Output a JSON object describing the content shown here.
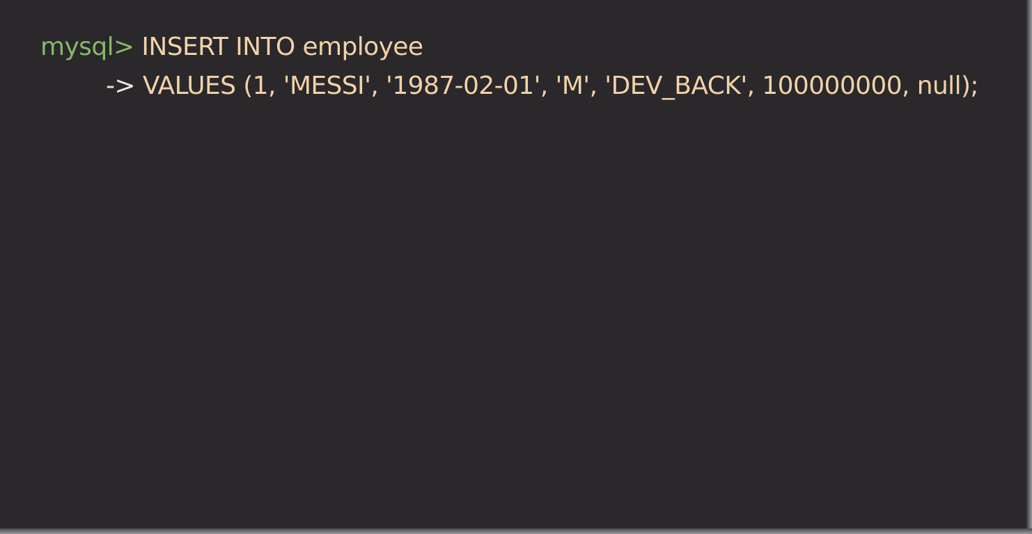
{
  "terminal": {
    "lines": [
      {
        "prompt": "mysql>",
        "text": "INSERT INTO employee"
      },
      {
        "prompt": "->",
        "text": "VALUES (1, 'MESSI', '1987-02-01', 'M', 'DEV_BACK', 100000000, null);"
      }
    ]
  },
  "colors": {
    "background": "#2a282b",
    "prompt": "#86b86a",
    "continuation": "#efe6dd",
    "sql": "#f2d2a9"
  }
}
